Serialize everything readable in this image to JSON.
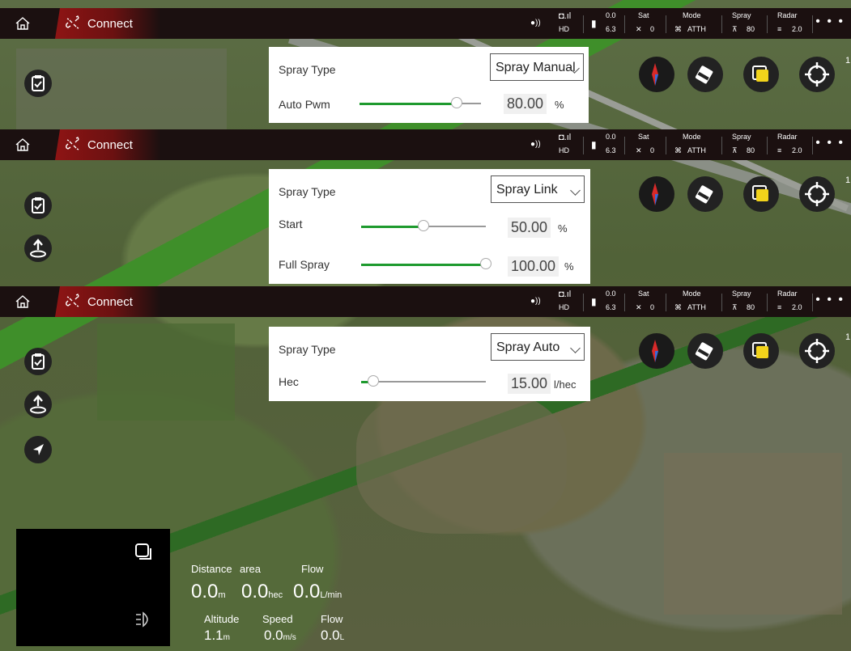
{
  "topbar": {
    "connect_label": "Connect",
    "rc_label": "HD",
    "battery_top": "0.0",
    "battery_bottom": "6.3",
    "sat_label": "Sat",
    "sat_value": "0",
    "mode_label": "Mode",
    "mode_value": "ATTH",
    "spray_label": "Spray",
    "spray_value": "80",
    "radar_label": "Radar",
    "radar_value": "2.0",
    "more": "• • •"
  },
  "panel1": {
    "spray_type_label": "Spray Type",
    "spray_type_value": "Spray Manual",
    "param_label": "Auto Pwm",
    "param_value": "80.00",
    "param_unit": "%",
    "param_fraction": 0.8
  },
  "panel2": {
    "spray_type_label": "Spray Type",
    "spray_type_value": "Spray Link",
    "start_label": "Start",
    "start_value": "50.00",
    "start_unit": "%",
    "start_fraction": 0.5,
    "full_label": "Full Spray",
    "full_value": "100.00",
    "full_unit": "%",
    "full_fraction": 1.0
  },
  "panel3": {
    "spray_type_label": "Spray Type",
    "spray_type_value": "Spray Auto",
    "hec_label": "Hec",
    "hec_value": "15.00",
    "hec_unit": "l/hec",
    "hec_fraction": 0.1
  },
  "right_edge_label": "1",
  "telemetry": {
    "distance_label": "Distance",
    "area_label": "area",
    "flow_label": "Flow",
    "distance_value": "0.0",
    "distance_unit": "m",
    "area_value": "0.0",
    "area_unit": "hec",
    "flow_value": "0.0",
    "flow_unit": "L/min",
    "altitude_label": "Altitude",
    "speed_label": "Speed",
    "flow2_label": "Flow",
    "altitude_value": "1.1",
    "altitude_unit": "m",
    "speed_value": "0.0",
    "speed_unit": "m/s",
    "flow2_value": "0.0",
    "flow2_unit": "L"
  },
  "icons": {
    "compass": "compass-icon",
    "eraser": "eraser-icon",
    "layer": "layer-square-icon",
    "locate": "crosshair-icon",
    "clipboard": "clipboard-icon",
    "takeoff": "takeoff-icon",
    "navigate": "navigate-arrow-icon",
    "camera_switch": "window-switch-icon",
    "light": "headlight-icon"
  },
  "colors": {
    "accent_green": "#1e9a2e",
    "connect_red": "#8e1414",
    "compass_red": "#d82a2a",
    "layer_yellow": "#f2d31b"
  }
}
